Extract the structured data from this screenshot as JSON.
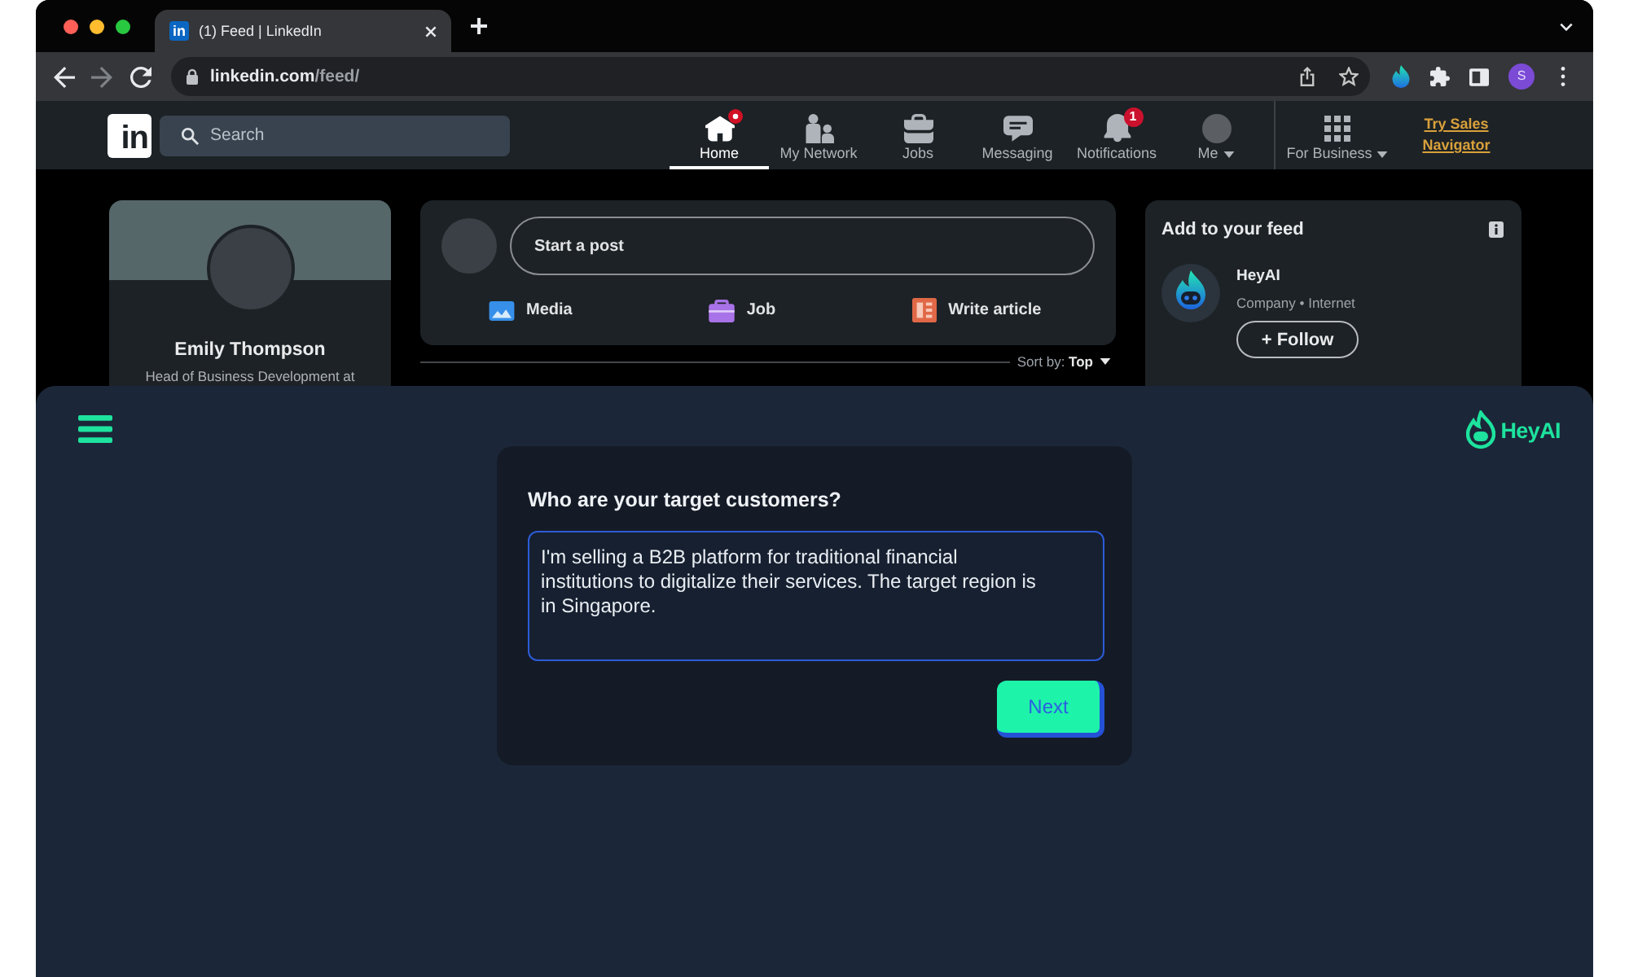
{
  "browser": {
    "tabs": [
      {
        "favicon": "in",
        "title": "(1) Feed | LinkedIn",
        "selected": true
      }
    ],
    "address": {
      "host": "linkedin.com",
      "path": "/feed/"
    },
    "profile_initial": "S"
  },
  "linkedin": {
    "logo": "in",
    "search": {
      "placeholder": "Search"
    },
    "nav": [
      {
        "kind": "home",
        "label": "Home",
        "selected": true,
        "dot": true
      },
      {
        "kind": "network",
        "label": "My Network",
        "selected": false,
        "dot": false
      },
      {
        "kind": "jobs",
        "label": "Jobs",
        "selected": false,
        "dot": false
      },
      {
        "kind": "messaging",
        "label": "Messaging",
        "selected": false,
        "dot": false
      },
      {
        "kind": "notifications",
        "label": "Notifications",
        "selected": false,
        "dot": false,
        "badge": "1"
      },
      {
        "kind": "me",
        "label": "Me",
        "selected": false,
        "dot": false
      },
      {
        "kind": "business",
        "label": "For Business",
        "selected": false,
        "dot": false
      }
    ],
    "sales_link": "Try Sales Navigator"
  },
  "profile": {
    "name": "Emily Thompson",
    "headline": "Head of Business Development at"
  },
  "composer": {
    "prompt": "Start a post",
    "actions": [
      {
        "kind": "media",
        "label": "Media"
      },
      {
        "kind": "job",
        "label": "Job"
      },
      {
        "kind": "article",
        "label": "Write article"
      }
    ]
  },
  "sort": {
    "label": "Sort by: **Top**"
  },
  "suggestions": {
    "title": "Add to your feed",
    "items": [
      {
        "name": "HeyAI",
        "subtitle": "Company • Internet",
        "action": "+ Follow"
      }
    ]
  },
  "heyai": {
    "brand": "HeyAI",
    "question": "Who are your target customers?",
    "answer": {
      "value": "I'm selling a B2B platform for traditional financial institutions to digitalize their services. The target region is in Singapore."
    },
    "next": "Next"
  }
}
